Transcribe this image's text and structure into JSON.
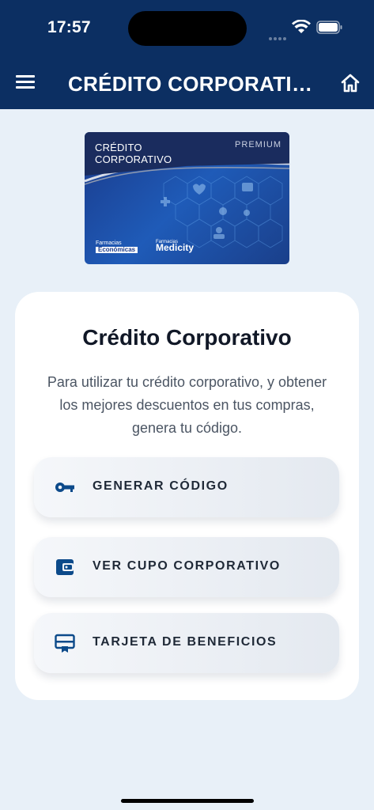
{
  "status_bar": {
    "time": "17:57"
  },
  "header": {
    "title": "CRÉDITO CORPORATIVO"
  },
  "card": {
    "title_line1": "CRÉDITO",
    "title_line2": "CORPORATIVO",
    "premium": "PREMIUM",
    "logo1_small": "Farmacias",
    "logo1_big": "Económicas",
    "logo2_small": "Farmacias",
    "logo2_big": "Medicity"
  },
  "panel": {
    "title": "Crédito Corporativo",
    "description": "Para utilizar tu crédito corporativo, y obtener los mejores descuentos en tus compras, genera tu código.",
    "actions": [
      {
        "label": "GENERAR CÓDIGO",
        "icon": "key-icon"
      },
      {
        "label": "VER CUPO CORPORATIVO",
        "icon": "wallet-icon"
      },
      {
        "label": "TARJETA DE BENEFICIOS",
        "icon": "card-icon"
      }
    ]
  },
  "colors": {
    "header_bg": "#0c2f62",
    "page_bg": "#e8f0f8",
    "icon_accent": "#0c4a8a"
  }
}
